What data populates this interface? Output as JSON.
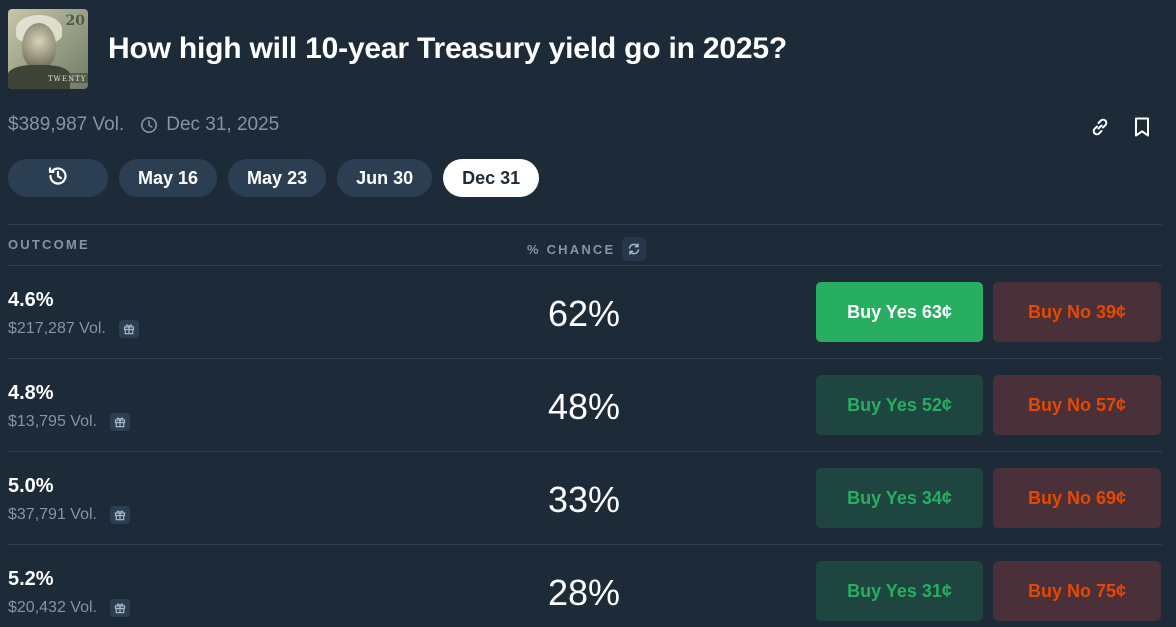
{
  "market": {
    "title": "How high will 10-year Treasury yield go in 2025?",
    "volume": "$389,987 Vol.",
    "end_date": "Dec 31, 2025",
    "thumbnail_text": "TWENTY",
    "thumbnail_number": "20"
  },
  "tabs": [
    {
      "label": "May 16"
    },
    {
      "label": "May 23"
    },
    {
      "label": "Jun 30"
    },
    {
      "label": "Dec 31",
      "active": true
    }
  ],
  "table": {
    "outcome_header": "OUTCOME",
    "chance_header": "% CHANCE",
    "rows": [
      {
        "outcome": "4.6%",
        "volume": "$217,287 Vol.",
        "chance": "62%",
        "buy_yes": "Buy Yes 63¢",
        "buy_no": "Buy No 39¢"
      },
      {
        "outcome": "4.8%",
        "volume": "$13,795 Vol.",
        "chance": "48%",
        "buy_yes": "Buy Yes 52¢",
        "buy_no": "Buy No 57¢"
      },
      {
        "outcome": "5.0%",
        "volume": "$37,791 Vol.",
        "chance": "33%",
        "buy_yes": "Buy Yes 34¢",
        "buy_no": "Buy No 69¢"
      },
      {
        "outcome": "5.2%",
        "volume": "$20,432 Vol.",
        "chance": "28%",
        "buy_yes": "Buy Yes 31¢",
        "buy_no": "Buy No 75¢"
      }
    ]
  },
  "icons": [
    "history-icon",
    "clock-icon",
    "link-icon",
    "bookmark-icon",
    "refresh-icon",
    "gift-icon"
  ],
  "colors": {
    "background": "#1d2b39",
    "yes_green": "#27ae60",
    "no_orange": "#e64800",
    "muted_text": "#8494a4"
  }
}
